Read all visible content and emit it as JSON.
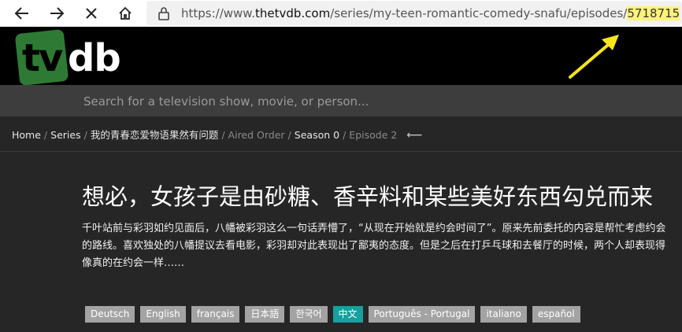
{
  "browser": {
    "url_prefix": "https://www.",
    "url_host": "thetvdb.com",
    "url_path": "/series/my-teen-romantic-comedy-snafu/episodes/",
    "url_highlight": "5718715"
  },
  "site": {
    "logo_tv": "tv",
    "logo_db": "db"
  },
  "search": {
    "placeholder": "Search for a television show, movie, or person..."
  },
  "breadcrumb": {
    "home": "Home",
    "series": "Series",
    "show": "我的青春恋爱物语果然有问题",
    "order": "Aired Order",
    "season": "Season 0",
    "episode": "Episode 2"
  },
  "episode": {
    "title": "想必，女孩子是由砂糖、香辛料和某些美好东西勾兑而来",
    "overview": "千叶站前与彩羽如约见面后，八幡被彩羽这么一句话弄懵了，“从现在开始就是约会时间了”。原来先前委托的内容是帮忙考虑约会的路线。喜欢独处的八幡提议去看电影，彩羽却对此表现出了鄙夷的态度。但是之后在打乒乓球和去餐厅的时候，两个人却表现得像真的在约会一样……"
  },
  "languages": [
    {
      "label": "Deutsch",
      "active": false
    },
    {
      "label": "English",
      "active": false
    },
    {
      "label": "français",
      "active": false
    },
    {
      "label": "日本語",
      "active": false
    },
    {
      "label": "한국어",
      "active": false
    },
    {
      "label": "中文",
      "active": true
    },
    {
      "label": "Português - Portugal",
      "active": false
    },
    {
      "label": "italiano",
      "active": false
    },
    {
      "label": "español",
      "active": false
    }
  ],
  "colors": {
    "highlight": "#fff27a",
    "annotation_arrow": "#f5e51b",
    "logo_green": "#2e7a34",
    "active_language": "#16a0a0"
  }
}
